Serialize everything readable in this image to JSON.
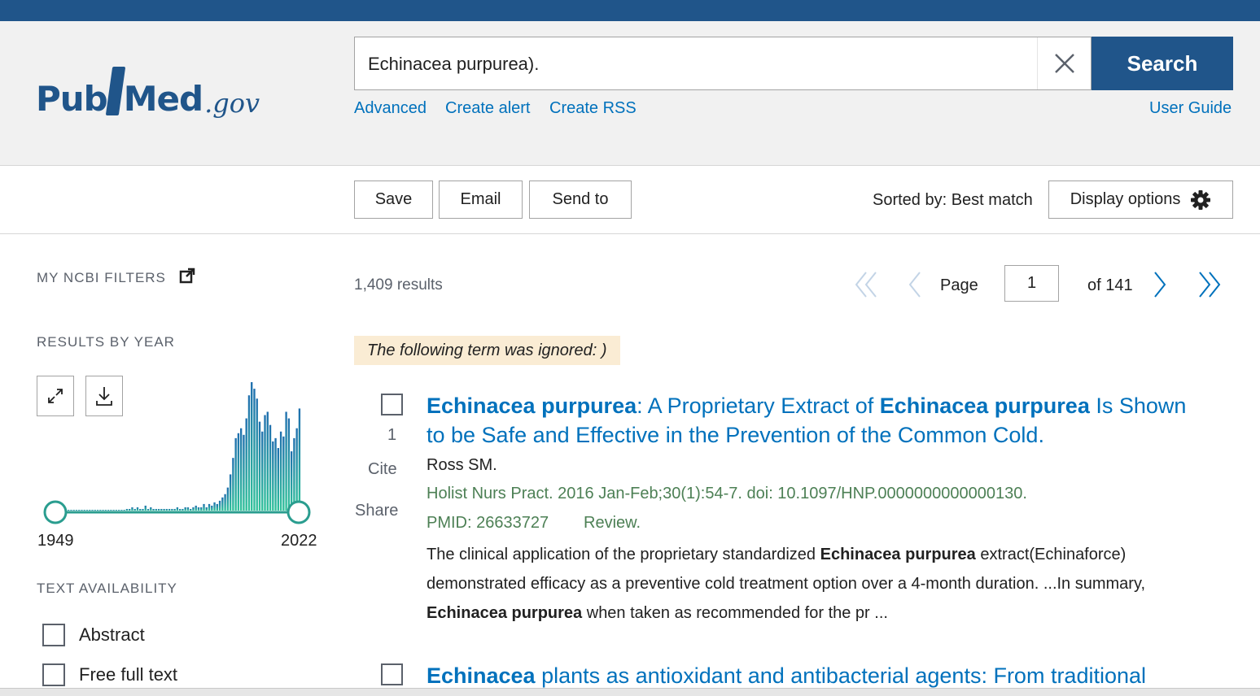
{
  "header": {
    "logo": {
      "pub": "Pub",
      "med": "Med",
      "gov": ".gov"
    },
    "search": {
      "value": "Echinacea purpurea).",
      "button_label": "Search"
    },
    "links": {
      "advanced": "Advanced",
      "create_alert": "Create alert",
      "create_rss": "Create RSS",
      "user_guide": "User Guide"
    }
  },
  "toolbar": {
    "save": "Save",
    "email": "Email",
    "send_to": "Send to",
    "sorted_by": "Sorted by: Best match",
    "display_options": "Display options"
  },
  "sidebar": {
    "my_ncbi_filters": "MY NCBI FILTERS",
    "results_by_year": "RESULTS BY YEAR",
    "year_start": "1949",
    "year_end": "2022",
    "text_availability": "TEXT AVAILABILITY",
    "filters": [
      {
        "label": "Abstract",
        "checked": false
      },
      {
        "label": "Free full text",
        "checked": false
      }
    ]
  },
  "results": {
    "count": "1,409 results",
    "page_label": "Page",
    "page_value": "1",
    "of_label": "of 141",
    "ignored_notice": "The following term was ignored: )",
    "items": [
      {
        "number": "1",
        "cite": "Cite",
        "share": "Share",
        "title_parts": [
          {
            "text": "Echinacea purpurea",
            "bold": true
          },
          {
            "text": ": A Proprietary Extract of ",
            "bold": false
          },
          {
            "text": "Echinacea purpurea",
            "bold": true
          },
          {
            "text": " Is Shown to be Safe and Effective in the Prevention of the Common Cold.",
            "bold": false
          }
        ],
        "authors": "Ross SM.",
        "journal": "Holist Nurs Pract. 2016 Jan-Feb;30(1):54-7. doi: 10.1097/HNP.0000000000000130.",
        "pmid": "PMID: 26633727",
        "pub_type": "Review.",
        "snippet_parts": [
          {
            "text": "The clinical application of the proprietary standardized ",
            "bold": false
          },
          {
            "text": "Echinacea purpurea",
            "bold": true
          },
          {
            "text": " extract(Echinaforce) demonstrated efficacy as a preventive cold treatment option over a 4-month duration. ...In summary, ",
            "bold": false
          },
          {
            "text": "Echinacea purpurea",
            "bold": true
          },
          {
            "text": " when taken as recommended for the pr ...",
            "bold": false
          }
        ]
      },
      {
        "title_parts": [
          {
            "text": "Echinacea",
            "bold": true
          },
          {
            "text": " plants as antioxidant and antibacterial agents: From traditional",
            "bold": false
          }
        ]
      }
    ]
  },
  "colors": {
    "brand": "#20558a",
    "link": "#0071bc",
    "chart_bar": "#2a9d8f",
    "citation_green": "#4d8055",
    "notice_bg": "#faecd4"
  },
  "chart_data": {
    "type": "bar",
    "x_range": [
      1949,
      2022
    ],
    "values": [
      0,
      0,
      0,
      0,
      0,
      0,
      0,
      0,
      0,
      0,
      0,
      0,
      0,
      0,
      0,
      0,
      0,
      0,
      0,
      0,
      0,
      0,
      1,
      1,
      2,
      1,
      2,
      1,
      1,
      3,
      1,
      2,
      1,
      1,
      1,
      1,
      1,
      1,
      1,
      1,
      1,
      2,
      1,
      1,
      2,
      2,
      1,
      2,
      3,
      2,
      2,
      4,
      2,
      4,
      3,
      5,
      4,
      6,
      8,
      10,
      14,
      22,
      32,
      44,
      47,
      50,
      46,
      56,
      70,
      78,
      74,
      68,
      54,
      48,
      58,
      60,
      52,
      42,
      44,
      38,
      48,
      45,
      60,
      56,
      36,
      44,
      50,
      62
    ]
  }
}
